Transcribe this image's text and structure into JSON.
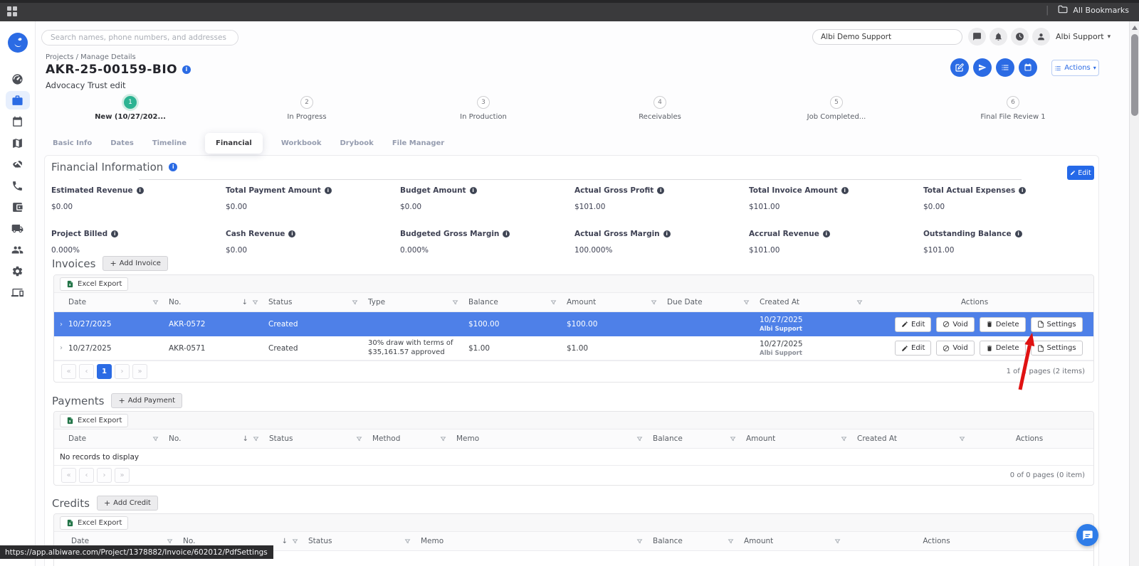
{
  "browser": {
    "bookmarks_label": "All Bookmarks",
    "status_url": "https://app.albiware.com/Project/1378882/Invoice/602012/PdfSettings"
  },
  "topbar": {
    "search_placeholder": "Search names, phone numbers, and addresses",
    "location_value": "Albi Demo Support",
    "user_label": "Albi Support"
  },
  "sidebar": {
    "items": [
      "dashboard",
      "projects",
      "calendar",
      "map",
      "handshake",
      "phone",
      "wallet",
      "truck",
      "team",
      "settings",
      "devices"
    ]
  },
  "page": {
    "breadcrumb": "Projects / Manage Details",
    "title": "AKR-25-00159-BIO",
    "subtitle": "Advocacy Trust edit",
    "actions_button": "Actions"
  },
  "stepper": [
    {
      "num": "1",
      "label": "New (10/27/202..."
    },
    {
      "num": "2",
      "label": "In Progress"
    },
    {
      "num": "3",
      "label": "In Production"
    },
    {
      "num": "4",
      "label": "Receivables"
    },
    {
      "num": "5",
      "label": "Job Completed..."
    },
    {
      "num": "6",
      "label": "Final File Review 1"
    }
  ],
  "tabs": [
    {
      "label": "Basic Info"
    },
    {
      "label": "Dates"
    },
    {
      "label": "Timeline"
    },
    {
      "label": "Financial"
    },
    {
      "label": "Workbook"
    },
    {
      "label": "Drybook"
    },
    {
      "label": "File Manager"
    }
  ],
  "labels": {
    "edit": "Edit",
    "void": "Void",
    "delete": "Delete",
    "settings": "Settings",
    "excel_export": "Excel Export"
  },
  "financial": {
    "heading": "Financial Information",
    "edit_button": "Edit",
    "fields": [
      {
        "label": "Estimated Revenue",
        "value": "$0.00"
      },
      {
        "label": "Total Payment Amount",
        "value": "$0.00"
      },
      {
        "label": "Budget Amount",
        "value": "$0.00"
      },
      {
        "label": "Actual Gross Profit",
        "value": "$101.00"
      },
      {
        "label": "Total Invoice Amount",
        "value": "$101.00"
      },
      {
        "label": "Total Actual Expenses",
        "value": "$0.00"
      },
      {
        "label": "Project Billed",
        "value": "0.000%"
      },
      {
        "label": "Cash Revenue",
        "value": "$0.00"
      },
      {
        "label": "Budgeted Gross Margin",
        "value": "0.000%"
      },
      {
        "label": "Actual Gross Margin",
        "value": "100.000%"
      },
      {
        "label": "Accrual Revenue",
        "value": "$101.00"
      },
      {
        "label": "Outstanding Balance",
        "value": "$101.00"
      }
    ]
  },
  "invoices": {
    "heading": "Invoices",
    "add_button": "Add Invoice",
    "columns": [
      "Date",
      "No.",
      "Status",
      "Type",
      "Balance",
      "Amount",
      "Due Date",
      "Created At",
      "Actions"
    ],
    "rows": [
      {
        "date": "10/27/2025",
        "no": "AKR-0572",
        "status": "Created",
        "type": "",
        "balance": "$100.00",
        "amount": "$100.00",
        "due_date": "",
        "created_date": "10/27/2025",
        "created_by": "Albi Support"
      },
      {
        "date": "10/27/2025",
        "no": "AKR-0571",
        "status": "Created",
        "type": "30% draw with terms of $35,161.57 approved",
        "balance": "$1.00",
        "amount": "$1.00",
        "due_date": "",
        "created_date": "10/27/2025",
        "created_by": "Albi Support"
      }
    ],
    "page_number": "1",
    "pagination_summary": "1 of 1 pages (2 items)"
  },
  "payments": {
    "heading": "Payments",
    "add_button": "Add Payment",
    "columns": [
      "Date",
      "No.",
      "Status",
      "Method",
      "Memo",
      "Balance",
      "Amount",
      "Created At",
      "Actions"
    ],
    "empty_text": "No records to display",
    "pagination_summary": "0 of 0 pages (0 item)"
  },
  "credits": {
    "heading": "Credits",
    "add_button": "Add Credit",
    "columns": [
      "Date",
      "No.",
      "Status",
      "Memo",
      "Balance",
      "Amount",
      "Actions"
    ]
  }
}
